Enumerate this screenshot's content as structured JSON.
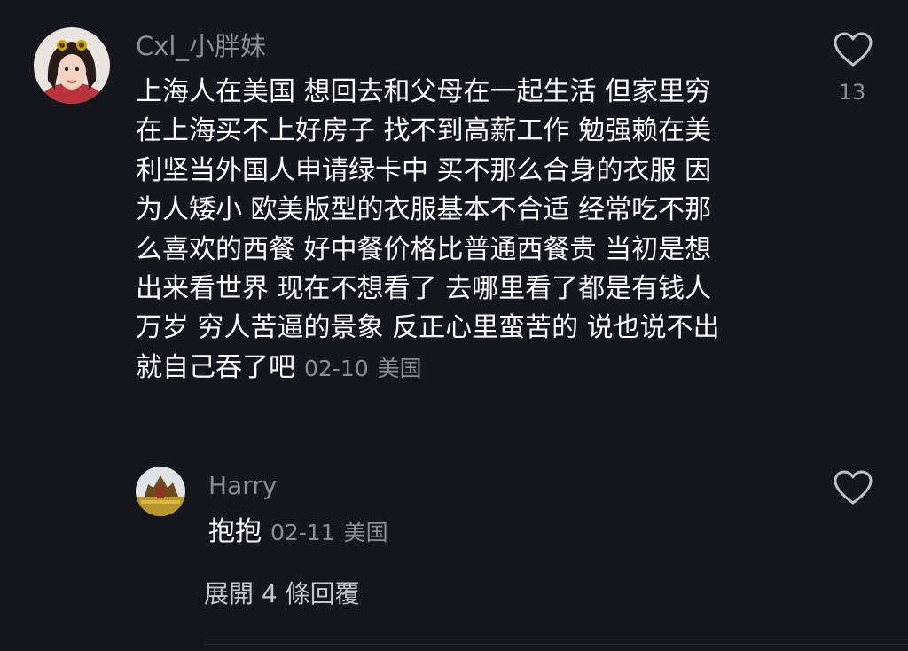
{
  "comment": {
    "username": "Cxl_小胖妹",
    "lines": [
      "上海人在美国 想回去和父母在一起生活 但家里穷",
      "在上海买不上好房子 找不到高薪工作 勉强赖在美",
      "利坚当外国人申请绿卡中 买不那么合身的衣服 因",
      "为人矮小 欧美版型的衣服基本不合适  经常吃不那",
      "么喜欢的西餐 好中餐价格比普通西餐贵 当初是想",
      "出来看世界 现在不想看了 去哪里看了都是有钱人",
      "万岁 穷人苦逼的景象 反正心里蛮苦的 说也说不出",
      "就自己吞了吧"
    ],
    "date": "02-10",
    "location": "美国",
    "like_count": "13",
    "like_icon": "heart-outline-icon"
  },
  "reply": {
    "username": "Harry",
    "text": "抱抱",
    "date": "02-11",
    "location": "美国",
    "like_icon": "heart-outline-icon"
  },
  "expand_replies_label": "展開 4 條回覆",
  "colors": {
    "background": "#16161d",
    "primary_text": "#ffffff",
    "secondary_text": "#8e8e96",
    "link_text": "#c7c8cf"
  }
}
